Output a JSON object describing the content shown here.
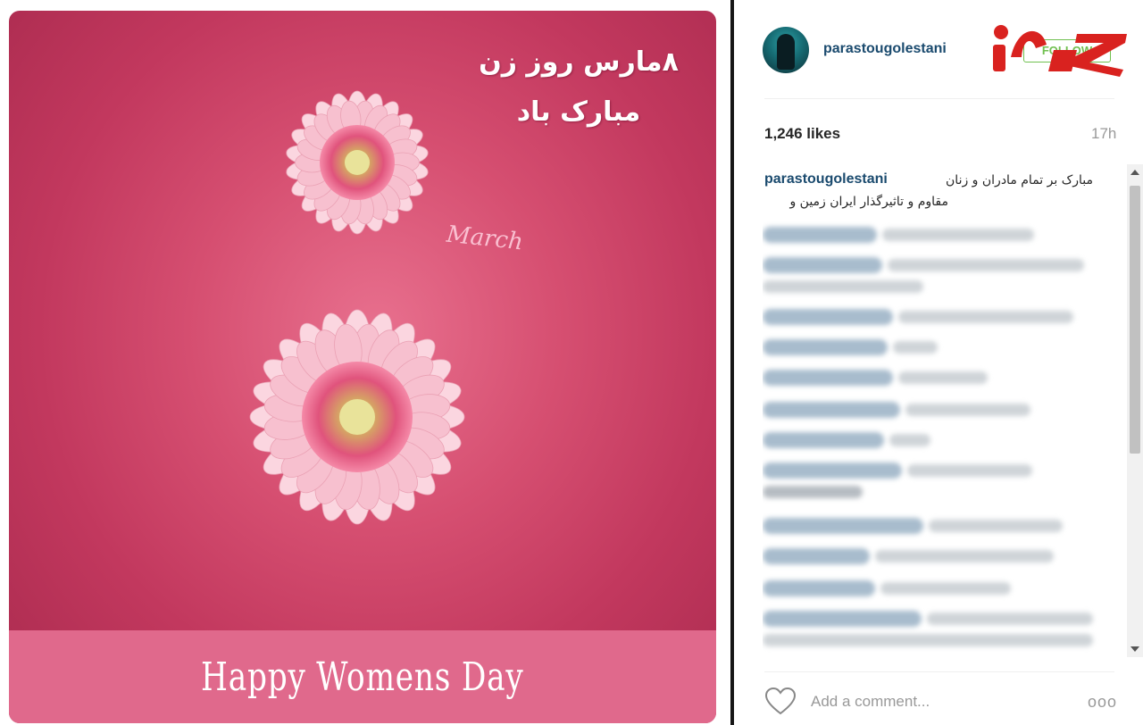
{
  "post": {
    "image": {
      "title_line1": "۸مارس روز زن",
      "title_line2": "مبارک باد",
      "script_label": "March",
      "banner_text": "Happy Womens Day"
    }
  },
  "header": {
    "username": "parastougolestani",
    "follow_label": "FOLLOW"
  },
  "stats": {
    "likes": "1,246 likes",
    "time": "17h"
  },
  "caption": {
    "username": "parastougolestani",
    "line1": "مبارک بر تمام مادران و زنان",
    "line2": "مقاوم و تاثیرگذار ایران زمین و"
  },
  "footer": {
    "add_comment_placeholder": "Add a comment...",
    "more_icon": "ooo"
  },
  "colors": {
    "image_bg": "#c2385e",
    "banner_bg": "#e0698c",
    "username": "#1a4a6e",
    "follow": "#70c050",
    "logo_red": "#d9221f"
  },
  "icons": [
    "heart-icon",
    "more-options-icon",
    "scroll-up-icon",
    "scroll-down-icon"
  ]
}
